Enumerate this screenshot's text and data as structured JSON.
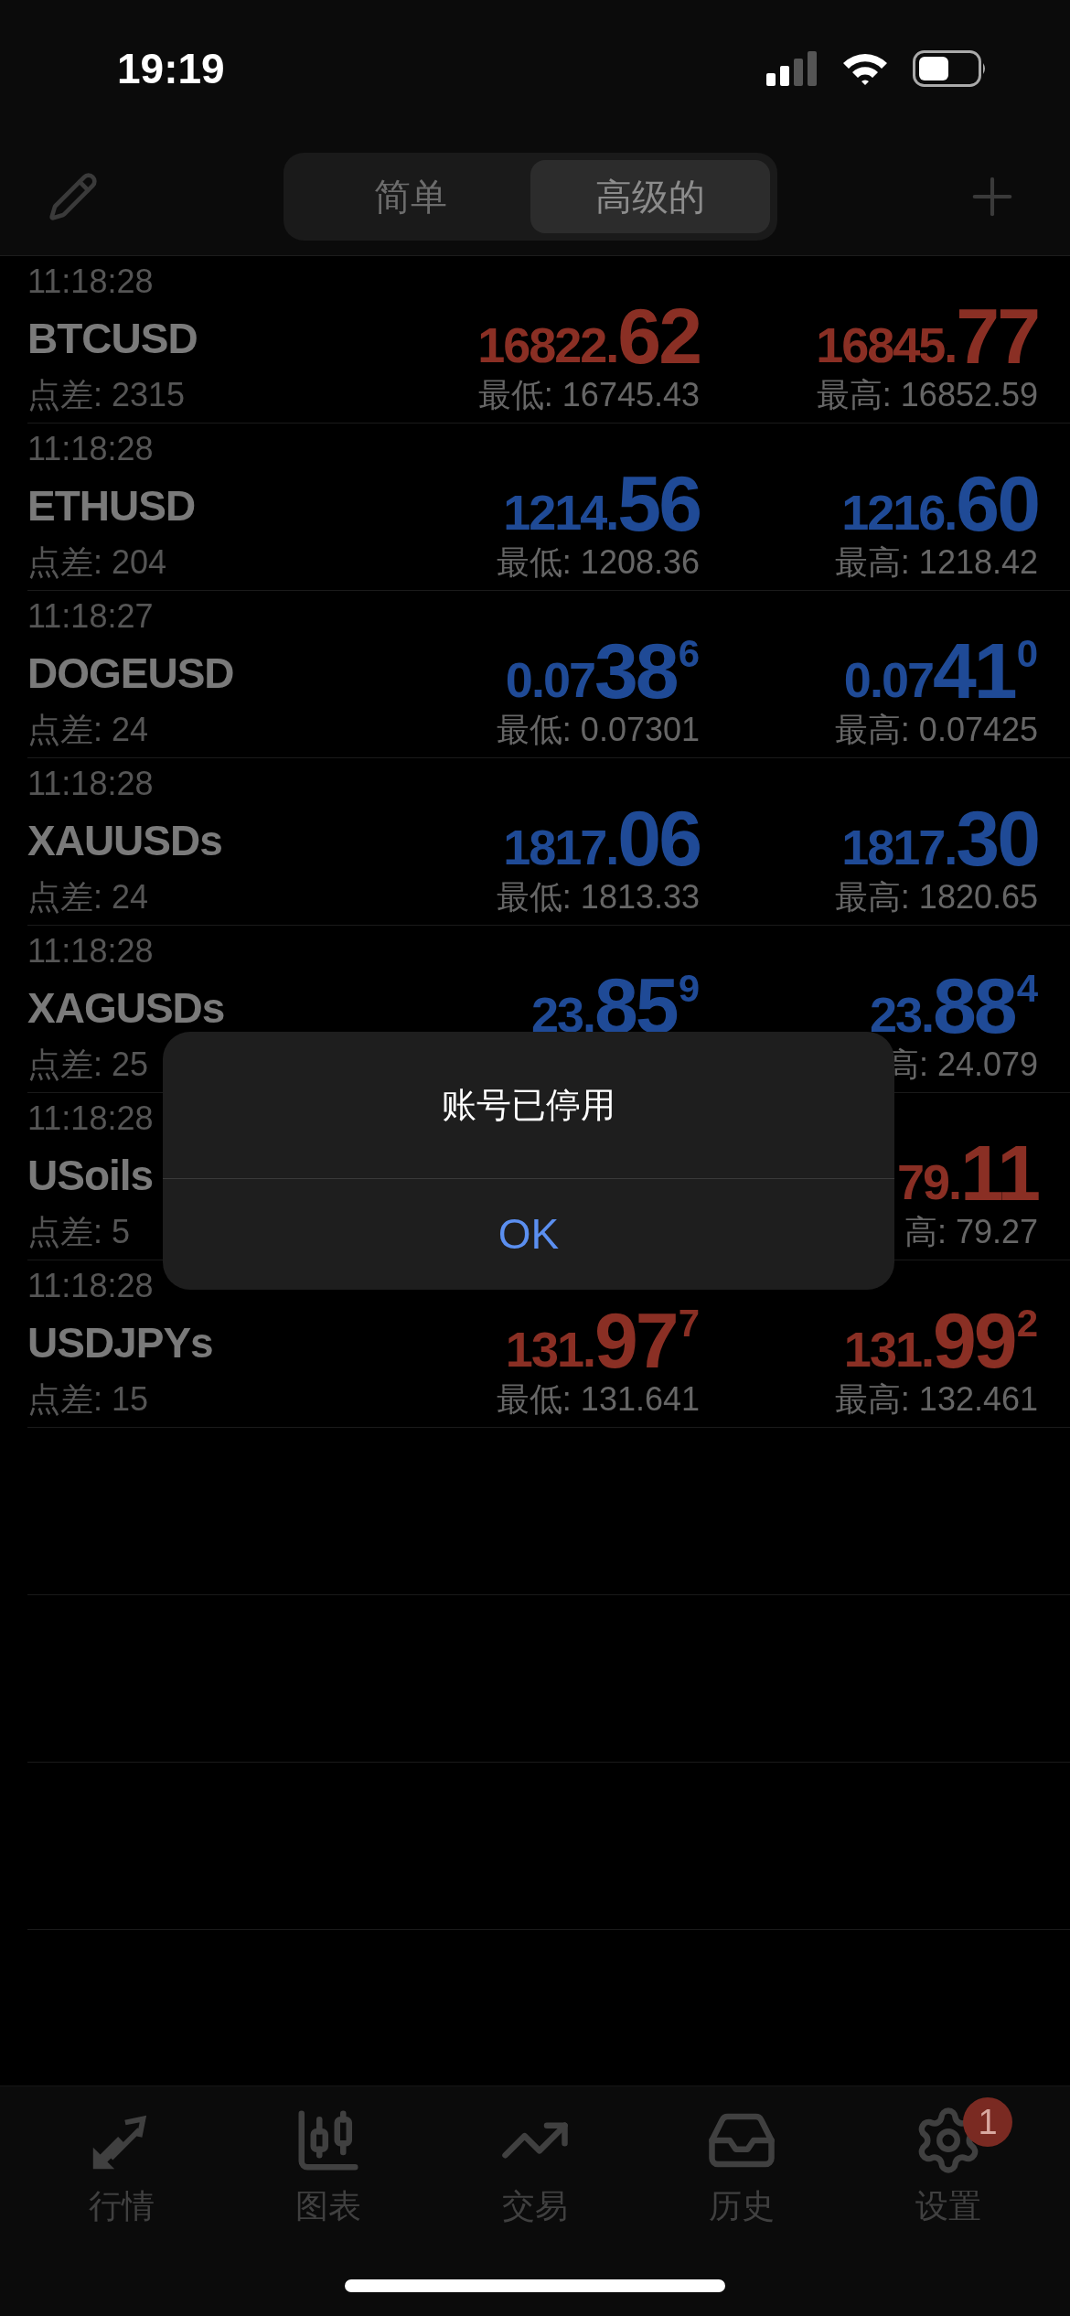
{
  "status_bar": {
    "time": "19:19"
  },
  "segmented": [
    {
      "label": "简单",
      "selected": false
    },
    {
      "label": "高级的",
      "selected": true
    }
  ],
  "quotes": [
    {
      "time": "11:18:28",
      "symbol": "BTCUSD",
      "spread": "点差: 2315",
      "bid": {
        "prefix": "16822.",
        "big": "62",
        "color": "#8a2f24"
      },
      "ask": {
        "prefix": "16845.",
        "big": "77",
        "color": "#8a2f24"
      },
      "low": "最低: 16745.43",
      "high": "最高: 16852.59"
    },
    {
      "time": "11:18:28",
      "symbol": "ETHUSD",
      "spread": "点差: 204",
      "bid": {
        "prefix": "1214.",
        "big": "56",
        "color": "#1f4a96"
      },
      "ask": {
        "prefix": "1216.",
        "big": "60",
        "color": "#1f4a96"
      },
      "low": "最低: 1208.36",
      "high": "最高: 1218.42"
    },
    {
      "time": "11:18:27",
      "symbol": "DOGEUSD",
      "spread": "点差: 24",
      "bid": {
        "prefix": "0.07",
        "big": "38",
        "sup": "6",
        "color": "#1f4a96"
      },
      "ask": {
        "prefix": "0.07",
        "big": "41",
        "sup": "0",
        "color": "#1f4a96"
      },
      "low": "最低: 0.07301",
      "high": "最高: 0.07425"
    },
    {
      "time": "11:18:28",
      "symbol": "XAUUSDs",
      "spread": "点差: 24",
      "bid": {
        "prefix": "1817.",
        "big": "06",
        "color": "#1f4a96"
      },
      "ask": {
        "prefix": "1817.",
        "big": "30",
        "color": "#1f4a96"
      },
      "low": "最低: 1813.33",
      "high": "最高: 1820.65"
    },
    {
      "time": "11:18:28",
      "symbol": "XAGUSDs",
      "spread": "点差: 25",
      "bid": {
        "prefix": "23.",
        "big": "85",
        "sup": "9",
        "color": "#1f4a96"
      },
      "ask": {
        "prefix": "23.",
        "big": "88",
        "sup": "4",
        "color": "#1f4a96"
      },
      "high": "高: 24.079"
    },
    {
      "time": "11:18:28",
      "symbol": "USoils",
      "spread": "点差: 5",
      "ask": {
        "prefix": "79.",
        "big": "11",
        "color": "#8a2f24"
      },
      "high": "高: 79.27"
    },
    {
      "time": "11:18:28",
      "symbol": "USDJPYs",
      "spread": "点差: 15",
      "bid": {
        "prefix": "131.",
        "big": "97",
        "sup": "7",
        "color": "#8a2f24"
      },
      "ask": {
        "prefix": "131.",
        "big": "99",
        "sup": "2",
        "color": "#8a2f24"
      },
      "low": "最低: 131.641",
      "high": "最高: 132.461"
    }
  ],
  "alert": {
    "message": "账号已停用",
    "button": "OK"
  },
  "tab_bar": [
    {
      "kind": "quotes",
      "label": "行情"
    },
    {
      "kind": "chart",
      "label": "图表"
    },
    {
      "kind": "trade",
      "label": "交易"
    },
    {
      "kind": "history",
      "label": "历史"
    },
    {
      "kind": "settings",
      "label": "设置",
      "badge": "1"
    }
  ]
}
